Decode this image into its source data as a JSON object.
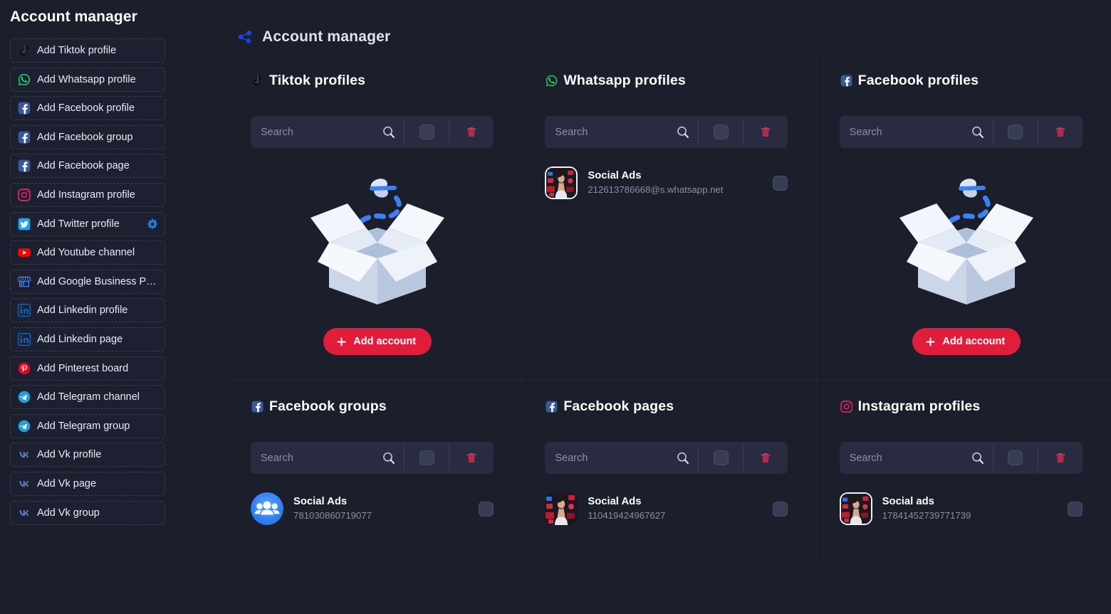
{
  "sidebar": {
    "title": "Account manager",
    "items": [
      {
        "label": "Add Tiktok profile",
        "icon": "tiktok-icon",
        "gear": false
      },
      {
        "label": "Add Whatsapp profile",
        "icon": "whatsapp-icon",
        "gear": false
      },
      {
        "label": "Add Facebook profile",
        "icon": "facebook-icon",
        "gear": false
      },
      {
        "label": "Add Facebook group",
        "icon": "facebook-icon",
        "gear": false
      },
      {
        "label": "Add Facebook page",
        "icon": "facebook-icon",
        "gear": false
      },
      {
        "label": "Add Instagram profile",
        "icon": "instagram-icon",
        "gear": false
      },
      {
        "label": "Add Twitter profile",
        "icon": "twitter-icon",
        "gear": true
      },
      {
        "label": "Add Youtube channel",
        "icon": "youtube-icon",
        "gear": false
      },
      {
        "label": "Add Google Business Pr…",
        "icon": "google-business-icon",
        "gear": false
      },
      {
        "label": "Add Linkedin profile",
        "icon": "linkedin-icon",
        "gear": false
      },
      {
        "label": "Add Linkedin page",
        "icon": "linkedin-icon",
        "gear": false
      },
      {
        "label": "Add Pinterest board",
        "icon": "pinterest-icon",
        "gear": false
      },
      {
        "label": "Add Telegram channel",
        "icon": "telegram-icon",
        "gear": false
      },
      {
        "label": "Add Telegram group",
        "icon": "telegram-icon",
        "gear": false
      },
      {
        "label": "Add Vk profile",
        "icon": "vk-icon",
        "gear": false
      },
      {
        "label": "Add Vk page",
        "icon": "vk-icon",
        "gear": false
      },
      {
        "label": "Add Vk group",
        "icon": "vk-icon",
        "gear": false
      }
    ]
  },
  "header": {
    "title": "Account manager",
    "icon": "share-nodes-icon"
  },
  "common": {
    "search_placeholder": "Search",
    "search_value": "",
    "add_account_label": "Add account",
    "search_icon": "magnifier-icon",
    "delete_icon": "trash-icon",
    "select_icon": "checkbox-icon"
  },
  "cards": [
    {
      "id": "tiktok-profiles",
      "title": "Tiktok profiles",
      "icon": "tiktok-icon",
      "empty": true,
      "accounts": []
    },
    {
      "id": "whatsapp-profiles",
      "title": "Whatsapp profiles",
      "icon": "whatsapp-icon",
      "empty": false,
      "accounts": [
        {
          "name": "Social Ads",
          "identifier": "212613786668@s.whatsapp.net",
          "avatar": "photo-framed"
        }
      ]
    },
    {
      "id": "facebook-profiles",
      "title": "Facebook profiles",
      "icon": "facebook-icon",
      "empty": true,
      "accounts": []
    },
    {
      "id": "facebook-groups",
      "title": "Facebook groups",
      "icon": "facebook-icon",
      "empty": false,
      "accounts": [
        {
          "name": "Social Ads",
          "identifier": "781030860719077",
          "avatar": "group-round"
        }
      ]
    },
    {
      "id": "facebook-pages",
      "title": "Facebook pages",
      "icon": "facebook-icon",
      "empty": false,
      "accounts": [
        {
          "name": "Social Ads",
          "identifier": "110419424967627",
          "avatar": "photo-plain"
        }
      ]
    },
    {
      "id": "instagram-profiles",
      "title": "Instagram profiles",
      "icon": "instagram-icon",
      "empty": false,
      "accounts": [
        {
          "name": "Social ads",
          "identifier": "17841452739771739",
          "avatar": "photo-framed"
        }
      ]
    }
  ],
  "colors": {
    "background": "#1b1e2b",
    "panel": "#292c40",
    "accent_red": "#e11d3c",
    "accent_blue": "#1a41f0",
    "text_primary": "#ffffff",
    "text_muted": "#8b8fa6"
  }
}
